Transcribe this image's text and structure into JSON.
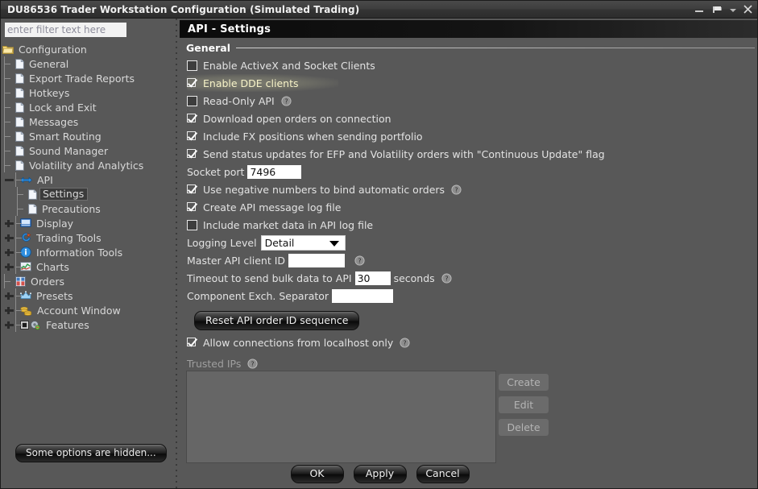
{
  "window": {
    "title": "DU86536 Trader Workstation Configuration (Simulated Trading)",
    "controls": {
      "minimize": "minimize-icon",
      "flag": "flag-icon",
      "chevron": "chevron-down-icon",
      "close": "close-icon"
    }
  },
  "sidebar": {
    "filter": {
      "placeholder": "enter filter text here",
      "value": ""
    },
    "hidden_notice": "Some options are hidden...",
    "tree": [
      {
        "label": "Configuration",
        "icon": "folder-icon",
        "level": 0,
        "toggle": "none",
        "selected": false
      },
      {
        "label": "General",
        "icon": "document-icon",
        "level": 1,
        "toggle": "none",
        "selected": false
      },
      {
        "label": "Export Trade Reports",
        "icon": "document-icon",
        "level": 1,
        "toggle": "none",
        "selected": false
      },
      {
        "label": "Hotkeys",
        "icon": "document-icon",
        "level": 1,
        "toggle": "none",
        "selected": false
      },
      {
        "label": "Lock and Exit",
        "icon": "document-icon",
        "level": 1,
        "toggle": "none",
        "selected": false
      },
      {
        "label": "Messages",
        "icon": "document-icon",
        "level": 1,
        "toggle": "none",
        "selected": false
      },
      {
        "label": "Smart Routing",
        "icon": "document-icon",
        "level": 1,
        "toggle": "none",
        "selected": false
      },
      {
        "label": "Sound Manager",
        "icon": "document-icon",
        "level": 1,
        "toggle": "none",
        "selected": false
      },
      {
        "label": "Volatility and Analytics",
        "icon": "document-icon",
        "level": 1,
        "toggle": "none",
        "selected": false
      },
      {
        "label": "API",
        "icon": "api-arrows-icon",
        "level": 1,
        "toggle": "minus",
        "selected": false
      },
      {
        "label": "Settings",
        "icon": "document-icon",
        "level": 2,
        "toggle": "none",
        "selected": true
      },
      {
        "label": "Precautions",
        "icon": "document-icon",
        "level": 2,
        "toggle": "none",
        "selected": false
      },
      {
        "label": "Display",
        "icon": "display-icon",
        "level": 1,
        "toggle": "plus",
        "selected": false
      },
      {
        "label": "Trading Tools",
        "icon": "trading-tools-icon",
        "level": 1,
        "toggle": "plus",
        "selected": false
      },
      {
        "label": "Information Tools",
        "icon": "info-icon",
        "level": 1,
        "toggle": "plus",
        "selected": false
      },
      {
        "label": "Charts",
        "icon": "charts-icon",
        "level": 1,
        "toggle": "plus",
        "selected": false
      },
      {
        "label": "Orders",
        "icon": "orders-icon",
        "level": 1,
        "toggle": "none",
        "selected": false
      },
      {
        "label": "Presets",
        "icon": "presets-icon",
        "level": 1,
        "toggle": "plus",
        "selected": false
      },
      {
        "label": "Account Window",
        "icon": "account-window-icon",
        "level": 1,
        "toggle": "plus",
        "selected": false
      },
      {
        "label": "Features",
        "icon": "features-gear-icon",
        "level": 1,
        "toggle": "plus",
        "selected": false
      }
    ]
  },
  "page": {
    "header": "API - Settings",
    "group": "General",
    "checkboxes": {
      "activex": {
        "label": "Enable ActiveX and Socket Clients",
        "checked": false
      },
      "dde": {
        "label": "Enable DDE clients",
        "checked": true,
        "highlighted": true
      },
      "readonly": {
        "label": "Read-Only API",
        "checked": false,
        "help": true
      },
      "download_orders": {
        "label": "Download open orders on connection",
        "checked": true
      },
      "fx_positions": {
        "label": "Include FX positions when sending portfolio",
        "checked": true
      },
      "efp_status": {
        "label": "Send status updates for EFP and Volatility orders with \"Continuous Update\" flag",
        "checked": true
      },
      "negative_numbers": {
        "label": "Use negative numbers to bind automatic orders",
        "checked": true,
        "help": true
      },
      "msg_log": {
        "label": "Create API message log file",
        "checked": true
      },
      "market_data_log": {
        "label": "Include market data in API log file",
        "checked": false
      },
      "localhost_only": {
        "label": "Allow connections from localhost only",
        "checked": true,
        "help": true
      }
    },
    "fields": {
      "socket_port": {
        "label": "Socket port",
        "value": "7496"
      },
      "logging_level": {
        "label": "Logging Level",
        "value": "Detail"
      },
      "master_client_id": {
        "label": "Master API client ID",
        "value": "",
        "help": true
      },
      "timeout": {
        "label": "Timeout to send bulk data to API",
        "value": "30",
        "unit": "seconds",
        "help": true
      },
      "separator": {
        "label": "Component Exch. Separator",
        "value": ""
      }
    },
    "reset_button": "Reset API order ID sequence",
    "trusted_ips": {
      "label": "Trusted IPs",
      "help": true,
      "entries": [],
      "buttons": [
        "Create",
        "Edit",
        "Delete"
      ]
    }
  },
  "dialog_buttons": [
    "OK",
    "Apply",
    "Cancel"
  ],
  "colors": {
    "background": "#585858",
    "panel_dark": "#0b0b0b",
    "highlight_text": "#f7f3c8",
    "text": "#e3e3e3",
    "dim_text": "#9f9f9f"
  }
}
